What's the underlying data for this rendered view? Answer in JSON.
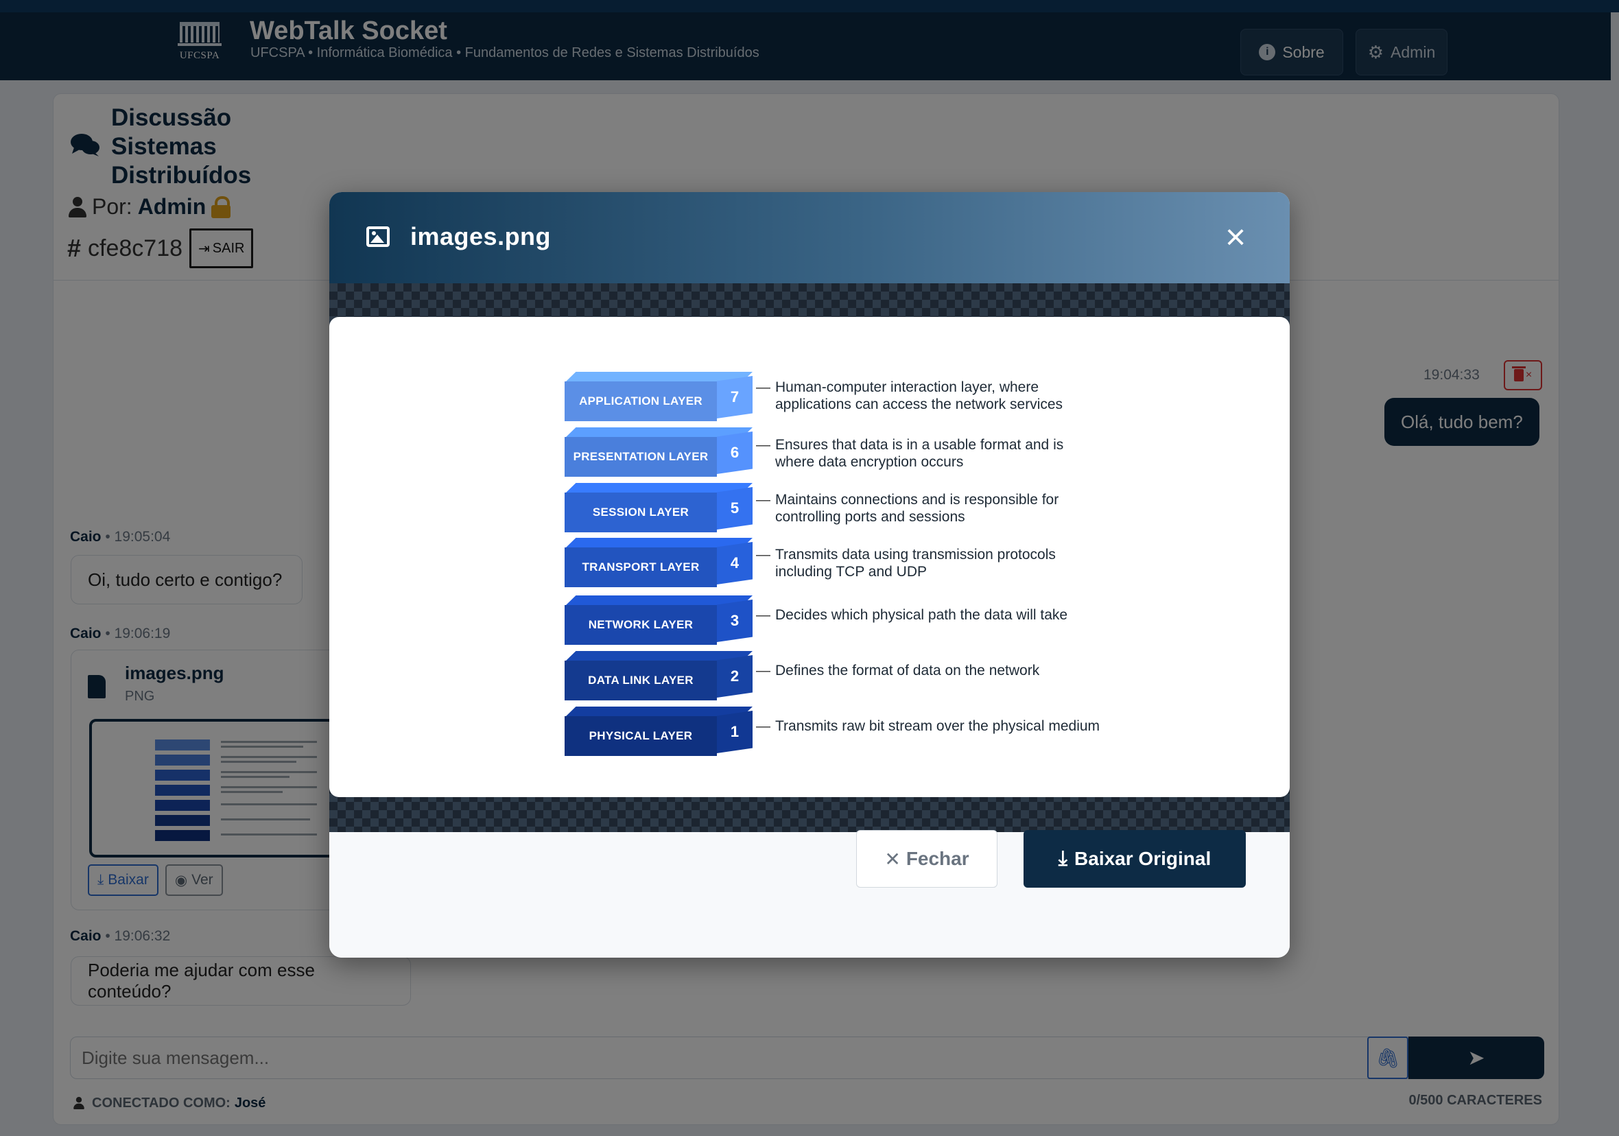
{
  "header": {
    "logo_text": "UFCSPA",
    "title": "WebTalk Socket",
    "subtitle": "UFCSPA • Informática Biomédica • Fundamentos de Redes e Sistemas Distribuídos",
    "buttons": {
      "sobre": "Sobre",
      "admin": "Admin"
    }
  },
  "room": {
    "title": "Discussão Sistemas Distribuídos",
    "by_label": "Por:",
    "owner": "Admin",
    "id": "cfe8c718",
    "leave_label": "SAIR"
  },
  "messages": {
    "outgoing": {
      "time": "19:04:33",
      "text": "Olá, tudo bem?"
    },
    "m1": {
      "author": "Caio",
      "time": "• 19:05:04",
      "text": "Oi, tudo certo e contigo?"
    },
    "m2": {
      "author": "Caio",
      "time": "• 19:06:19",
      "file_name": "images.png",
      "file_type": "PNG",
      "download_label": "Baixar",
      "view_label": "Ver"
    },
    "m3": {
      "author": "Caio",
      "time": "• 19:06:32",
      "text": "Poderia me ajudar com esse conteúdo?"
    }
  },
  "composer": {
    "placeholder": "Digite sua mensagem...",
    "connected_label": "CONECTADO COMO:",
    "connected_user": "José",
    "char_count": "0/500 CARACTERES"
  },
  "modal": {
    "title": "images.png",
    "close_label": "Fechar",
    "download_label": "Baixar Original",
    "layers": [
      {
        "num": "7",
        "name": "APPLICATION LAYER",
        "color": "#5b8fe6",
        "desc1": "Human-computer interaction layer, where",
        "desc2": "applications can access the network services"
      },
      {
        "num": "6",
        "name": "PRESENTATION LAYER",
        "color": "#4a7fdc",
        "desc1": "Ensures that data is in a usable format and is",
        "desc2": "where data encryption occurs"
      },
      {
        "num": "5",
        "name": "SESSION LAYER",
        "color": "#2d63d1",
        "desc1": "Maintains connections and is responsible for",
        "desc2": "controlling ports and sessions"
      },
      {
        "num": "4",
        "name": "TRANSPORT LAYER",
        "color": "#2254bf",
        "desc1": "Transmits data using transmission protocols",
        "desc2": "including TCP and UDP"
      },
      {
        "num": "3",
        "name": "NETWORK LAYER",
        "color": "#1a47ad",
        "desc1": "Decides which physical path the data will take",
        "desc2": ""
      },
      {
        "num": "2",
        "name": "DATA LINK LAYER",
        "color": "#143a8f",
        "desc1": "Defines the format of data on the network",
        "desc2": ""
      },
      {
        "num": "1",
        "name": "PHYSICAL LAYER",
        "color": "#0f3180",
        "desc1": "Transmits raw bit stream over the physical medium",
        "desc2": ""
      }
    ]
  }
}
